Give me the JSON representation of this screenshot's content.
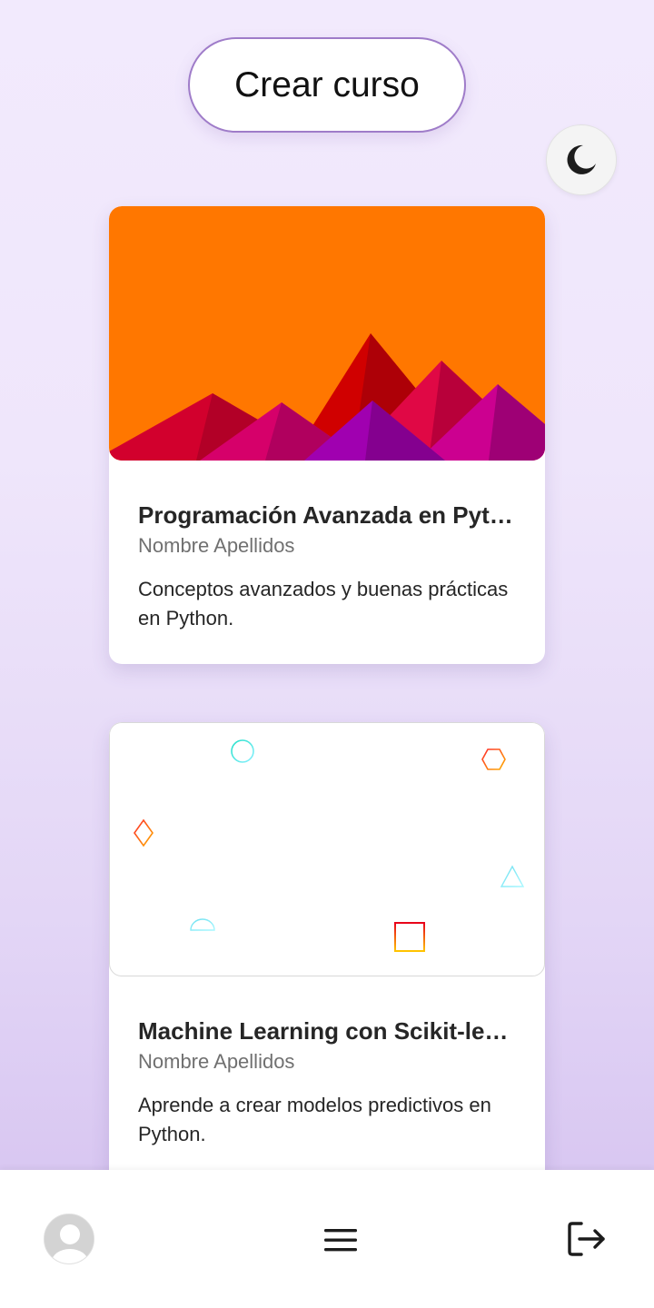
{
  "header": {
    "create_label": "Crear curso"
  },
  "theme_toggle": {
    "icon": "moon-icon"
  },
  "courses": [
    {
      "title": "Programación Avanzada en Python",
      "author": "Nombre Apellidos",
      "description": "Conceptos avanzados y buenas prácticas en Python.",
      "image": "orange-mountains-illustration"
    },
    {
      "title": "Machine Learning con Scikit-learn",
      "author": "Nombre Apellidos",
      "description": "Aprende a crear modelos predictivos en Python.",
      "image": "floating-geometric-shapes"
    }
  ],
  "bottom_nav": {
    "avatar_icon": "user-avatar-icon",
    "menu_icon": "hamburger-menu-icon",
    "logout_icon": "logout-icon"
  },
  "colors": {
    "accent_border": "#9f7cc9",
    "card1_background": "#ff7700"
  }
}
